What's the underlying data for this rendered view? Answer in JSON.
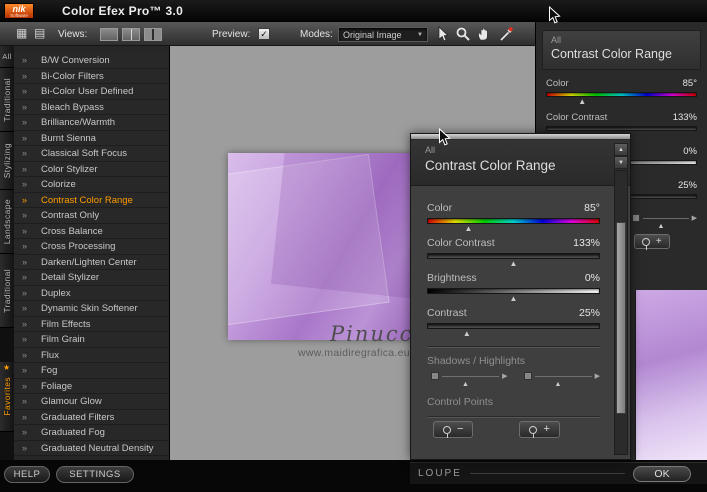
{
  "titlebar": {
    "logo_nik": "nik",
    "logo_software": "Software",
    "title": "Color Efex Pro™ 3.0"
  },
  "toolbar": {
    "views_label": "Views:",
    "preview_label": "Preview:",
    "modes_label": "Modes:",
    "mode_value": "Original Image"
  },
  "sidebar": {
    "tabs": [
      "All",
      "Traditional",
      "Stylizing",
      "Landscape",
      "Traditional",
      "Favorites"
    ],
    "selected_filter": "Contrast Color Range",
    "filters": [
      "B/W Conversion",
      "Bi-Color Filters",
      "Bi-Color User Defined",
      "Bleach Bypass",
      "Brilliance/Warmth",
      "Burnt Sienna",
      "Classical Soft Focus",
      "Color Stylizer",
      "Colorize",
      "Contrast Color Range",
      "Contrast Only",
      "Cross Balance",
      "Cross Processing",
      "Darken/Lighten Center",
      "Detail Stylizer",
      "Duplex",
      "Dynamic Skin Softener",
      "Film Effects",
      "Film Grain",
      "Flux",
      "Fog",
      "Foliage",
      "Glamour Glow",
      "Graduated Filters",
      "Graduated Fog",
      "Graduated Neutral Density"
    ]
  },
  "preview": {
    "watermark_title": "Pinuccia",
    "watermark_url": "www.maidiregrafica.eu"
  },
  "panel": {
    "category": "All",
    "title": "Contrast Color Range",
    "sliders": [
      {
        "label": "Color",
        "value": "85°",
        "type": "rainbow",
        "marker_pct": 24
      },
      {
        "label": "Color Contrast",
        "value": "133%",
        "type": "groove",
        "marker_pct": 50
      },
      {
        "label": "Brightness",
        "value": "0%",
        "type": "grayscale",
        "marker_pct": 50
      },
      {
        "label": "Contrast",
        "value": "25%",
        "type": "groove",
        "marker_pct": 23
      }
    ],
    "shadows_highlights_label": "Shadows / Highlights",
    "control_points_label": "Control Points",
    "minus_label": "−",
    "plus_label": "+"
  },
  "footer": {
    "help_label": "HELP",
    "settings_label": "SETTINGS",
    "loupe_label": "LOUPE",
    "ok_label": "OK"
  },
  "colors": {
    "accent": "#ff9c00"
  }
}
